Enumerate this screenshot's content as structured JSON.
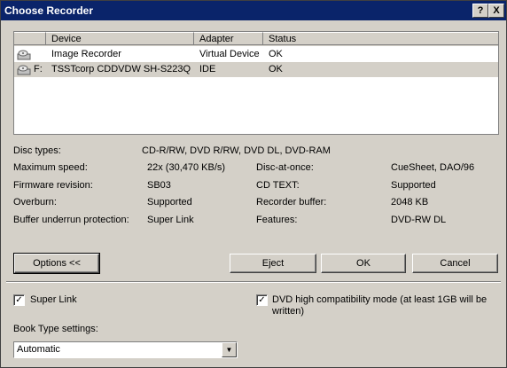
{
  "window": {
    "title": "Choose Recorder",
    "help_label": "?",
    "close_label": "X"
  },
  "device_list": {
    "columns": [
      "Device",
      "Adapter",
      "Status"
    ],
    "rows": [
      {
        "letter": "",
        "device": "Image Recorder",
        "adapter": "Virtual Device",
        "status": "OK",
        "icon": "image-recorder-icon"
      },
      {
        "letter": "F:",
        "device": "TSSTcorp CDDVDW SH-S223Q",
        "adapter": "IDE",
        "status": "OK",
        "icon": "optical-drive-icon"
      }
    ]
  },
  "info": {
    "disc_types": {
      "label": "Disc types:",
      "value": "CD-R/RW, DVD R/RW, DVD DL, DVD-RAM"
    },
    "max_speed": {
      "label": "Maximum speed:",
      "value": "22x (30,470 KB/s)"
    },
    "firmware": {
      "label": "Firmware revision:",
      "value": "SB03"
    },
    "overburn": {
      "label": "Overburn:",
      "value": "Supported"
    },
    "underrun": {
      "label": "Buffer underrun protection:",
      "value": "Super Link"
    },
    "disc_at_once": {
      "label": "Disc-at-once:",
      "value": "CueSheet, DAO/96"
    },
    "cd_text": {
      "label": "CD TEXT:",
      "value": "Supported"
    },
    "recorder_buffer": {
      "label": "Recorder buffer:",
      "value": "2048 KB"
    },
    "features": {
      "label": "Features:",
      "value": "DVD-RW DL"
    }
  },
  "buttons": {
    "options": "Options <<",
    "eject": "Eject",
    "ok": "OK",
    "cancel": "Cancel"
  },
  "options": {
    "super_link": {
      "label": "Super Link",
      "checked": true
    },
    "dvd_compat": {
      "label_line1": "DVD high compatibility mode (at least 1GB will be",
      "label_line2": "written)",
      "checked": true
    },
    "book_type": {
      "label": "Book Type settings:",
      "value": "Automatic"
    }
  }
}
